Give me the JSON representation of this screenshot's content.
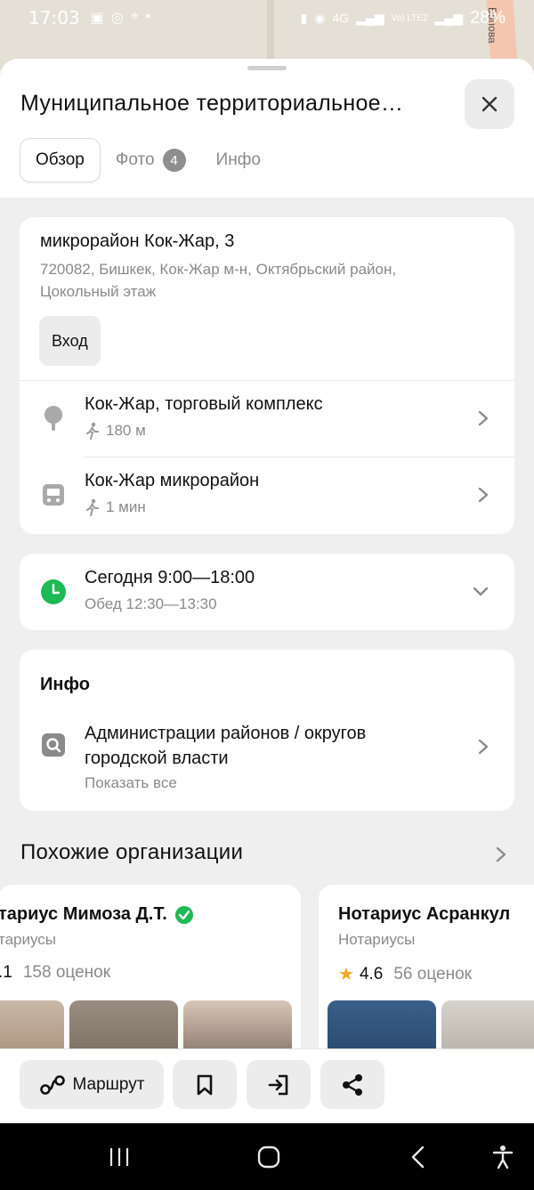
{
  "status_bar": {
    "time": "17:03",
    "battery": "28%",
    "network": "4G",
    "lte": "Vo) LTE2"
  },
  "map": {
    "street": "Бапова"
  },
  "header": {
    "title": "Муниципальное территориальное…",
    "close_icon": "close-icon"
  },
  "tabs": [
    {
      "label": "Обзор",
      "active": true
    },
    {
      "label": "Фото",
      "badge": "4"
    },
    {
      "label": "Инфо"
    }
  ],
  "address": {
    "line1": "микрорайон Кок-Жар, 3",
    "line2": "720082, Бишкек, Кок-Жар м-н, Октябрьский район,",
    "line3": "Цокольный этаж",
    "entrance_button": "Вход"
  },
  "nearby": [
    {
      "icon": "tree-pin-icon",
      "title": "Кок-Жар, торговый комплекс",
      "detail": "180 м"
    },
    {
      "icon": "bus-icon",
      "title": "Кок-Жар микрорайон",
      "detail": "1 мин"
    }
  ],
  "hours": {
    "today": "Сегодня 9:00—18:00",
    "lunch": "Обед 12:30—13:30"
  },
  "info": {
    "heading": "Инфо",
    "category_line1": "Администрации районов / округов",
    "category_line2": "городской власти",
    "show_all": "Показать все"
  },
  "similar": {
    "heading": "Похожие организации",
    "orgs": [
      {
        "name": "тариус Мимоза Д.Т.",
        "category": "тариусы",
        "rating": ".1",
        "reviews": "158 оценок",
        "verified": true
      },
      {
        "name": "Нотариус Асранкул",
        "category": "Нотариусы",
        "rating": "4.6",
        "reviews": "56 оценок",
        "verified": false
      }
    ]
  },
  "actions": {
    "route_label": "Маршрут",
    "bookmark_icon": "bookmark-icon",
    "enter_icon": "entrance-icon",
    "share_icon": "share-icon"
  },
  "colors": {
    "accent_green": "#1db954",
    "star": "#f5a623"
  }
}
